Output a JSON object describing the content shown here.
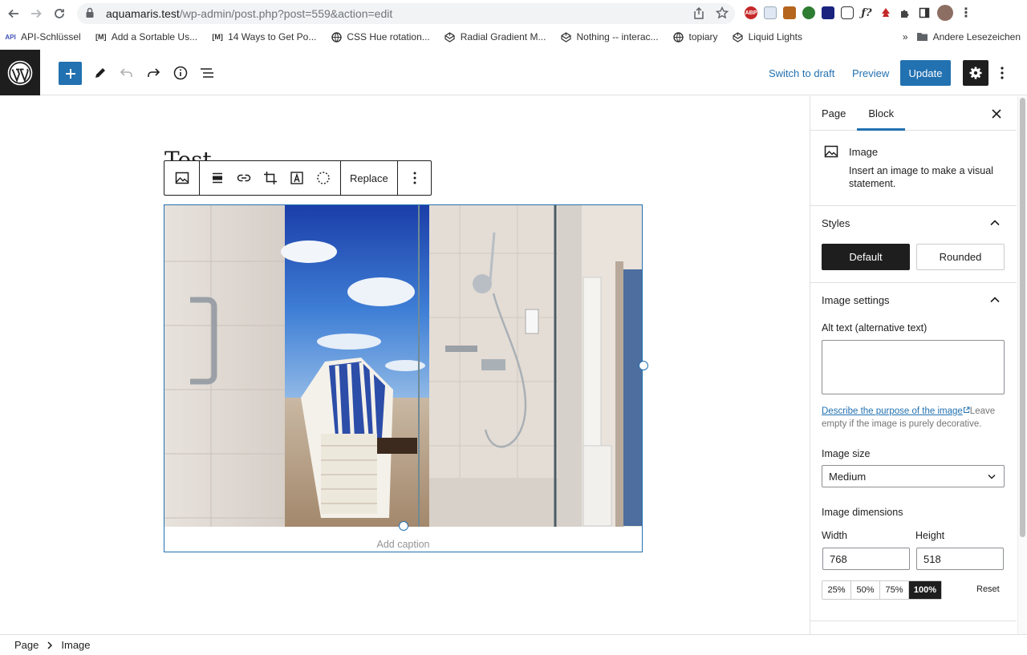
{
  "browser": {
    "url_domain": "aquamaris.test",
    "url_path": "/wp-admin/post.php?post=559&action=edit",
    "bookmarks": [
      {
        "icon": "API",
        "label": "API-Schlüssel"
      },
      {
        "icon": "M",
        "label": "Add a Sortable Us..."
      },
      {
        "icon": "M",
        "label": "14 Ways to Get Po..."
      },
      {
        "icon": "globe",
        "label": "CSS Hue rotation..."
      },
      {
        "icon": "codepen",
        "label": "Radial Gradient M..."
      },
      {
        "icon": "codepen",
        "label": "Nothing -- interac..."
      },
      {
        "icon": "globe",
        "label": "topiary"
      },
      {
        "icon": "codepen",
        "label": "Liquid Lights"
      }
    ],
    "more_bookmarks": "»",
    "other_bookmarks": "Andere Lesezeichen"
  },
  "header": {
    "switch_to_draft": "Switch to draft",
    "preview": "Preview",
    "update": "Update"
  },
  "toolbar": {
    "replace_label": "Replace"
  },
  "canvas": {
    "title_stub": "Test",
    "caption_placeholder": "Add caption"
  },
  "sidebar": {
    "tabs": [
      "Page",
      "Block"
    ],
    "active_tab": "Block",
    "block_title": "Image",
    "block_desc": "Insert an image to make a visual statement.",
    "styles_title": "Styles",
    "styles": [
      "Default",
      "Rounded"
    ],
    "selected_style": "Default",
    "image_settings_title": "Image settings",
    "alt_label": "Alt text (alternative text)",
    "alt_value": "",
    "help_link": "Describe the purpose of the image",
    "help_rest": "Leave empty if the image is purely decorative.",
    "image_size_label": "Image size",
    "image_size_value": "Medium",
    "dimensions_label": "Image dimensions",
    "width_label": "Width",
    "height_label": "Height",
    "width_value": "768",
    "height_value": "518",
    "percentages": [
      "25%",
      "50%",
      "75%",
      "100%"
    ],
    "selected_percentage": "100%",
    "reset_label": "Reset"
  },
  "footer": {
    "breadcrumb": [
      "Page",
      "Image"
    ]
  },
  "colors": {
    "accent": "#2271b1",
    "dark": "#1e1e1e"
  }
}
